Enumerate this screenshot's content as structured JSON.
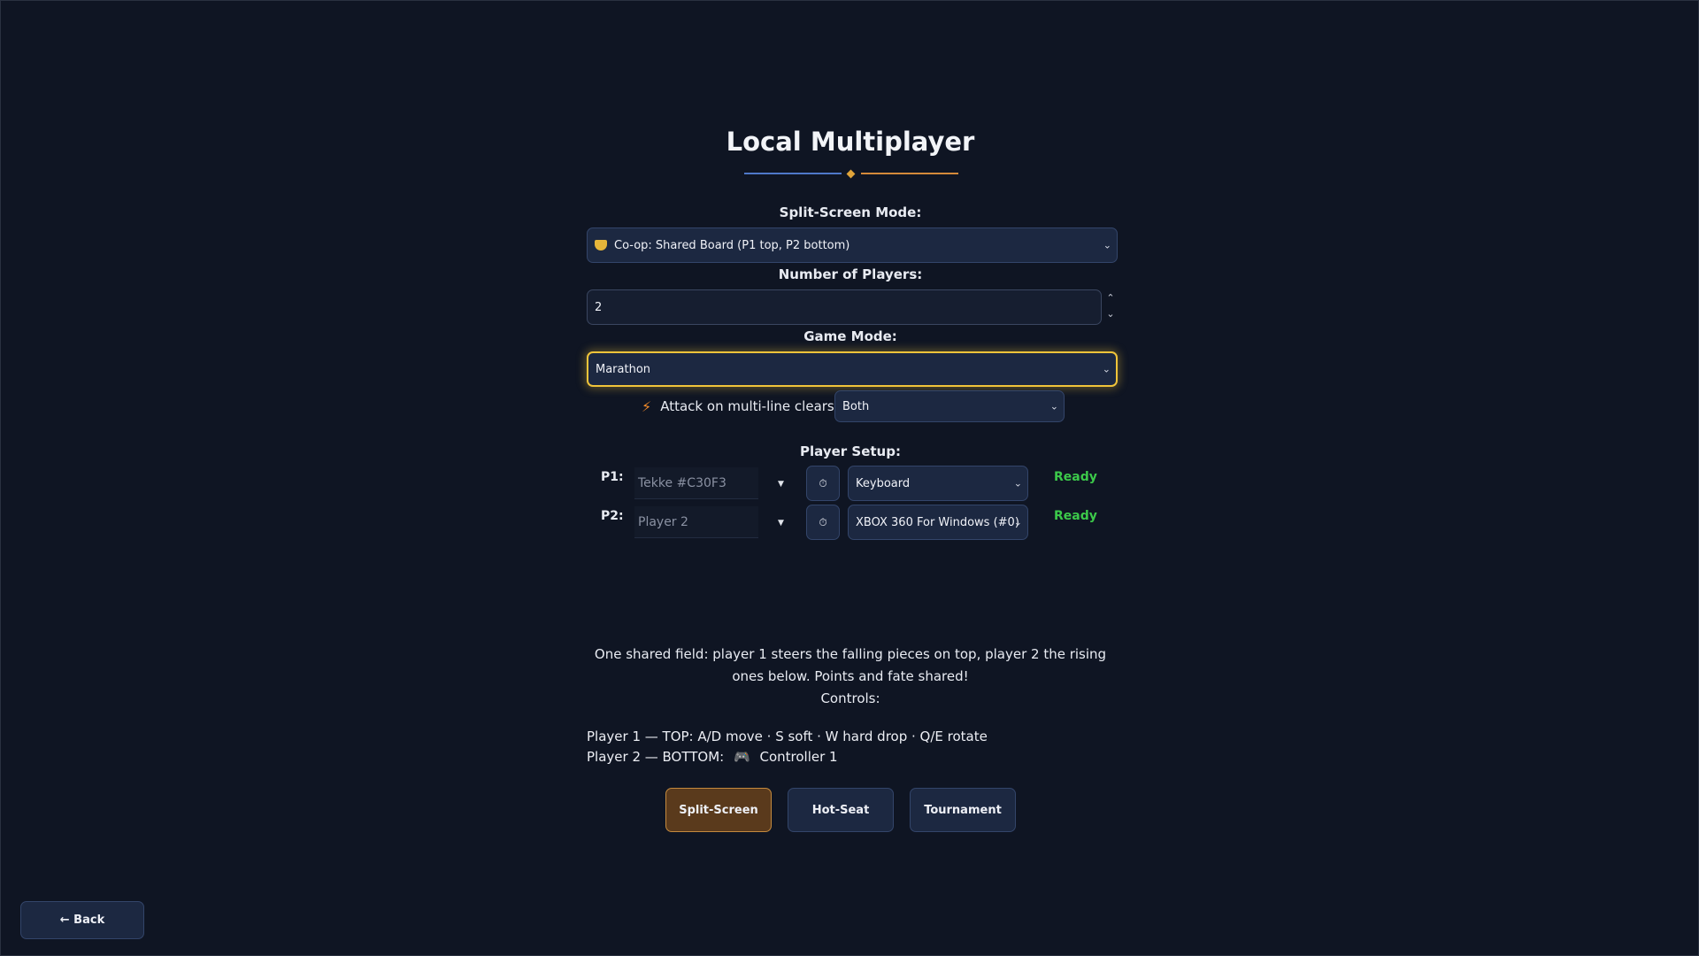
{
  "title": "Local Multiplayer",
  "split_screen": {
    "label": "Split-Screen Mode:",
    "icon": "shield-icon",
    "value": "Co-op: Shared Board (P1 top, P2 bottom)"
  },
  "players_count": {
    "label": "Number of Players:",
    "value": "2"
  },
  "game_mode": {
    "label": "Game Mode:",
    "value": "Marathon"
  },
  "attack": {
    "label": "Attack on multi-line clears:",
    "value": "Both"
  },
  "player_setup": {
    "label": "Player Setup:",
    "players": [
      {
        "label": "P1:",
        "name": "Tekke #C30F3",
        "device": "Keyboard",
        "status": "Ready"
      },
      {
        "label": "P2:",
        "name": "Player 2",
        "device": "XBOX 360 For Windows (#0)",
        "status": "Ready"
      }
    ]
  },
  "description": "One shared field: player 1 steers the falling pieces on top, player 2 the rising ones below. Points and fate shared!",
  "controls": {
    "label": "Controls:",
    "p1": "Player 1 — TOP: A/D move · S soft · W hard drop · Q/E rotate",
    "p2_prefix": "Player 2 — BOTTOM:",
    "p2_icon": "gamepad-icon",
    "p2_device": "Controller 1"
  },
  "modes": {
    "split_screen": "Split-Screen",
    "hot_seat": "Hot-Seat",
    "tournament": "Tournament",
    "active": "Split-Screen"
  },
  "back_label": "← Back",
  "colors": {
    "background": "#0f1523",
    "accent_gold": "#f0c43a",
    "ready_green": "#3cc94a",
    "active_mode": "#5a3a1c"
  }
}
